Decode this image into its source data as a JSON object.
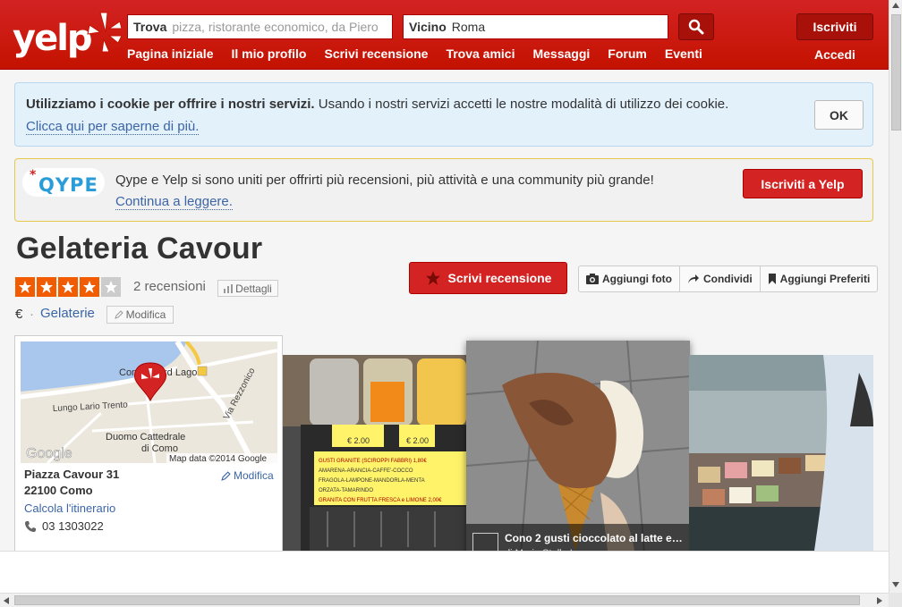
{
  "colors": {
    "brand_red": "#d32323",
    "dark_red": "#a8100a",
    "link_blue": "#3b65a7",
    "star_orange": "#f15c00"
  },
  "header": {
    "logo": "yelp",
    "find_label": "Trova",
    "find_placeholder": "pizza, ristorante economico, da Piero",
    "near_label": "Vicino",
    "near_value": "Roma",
    "search_icon": "search-icon",
    "nav": [
      "Pagina iniziale",
      "Il mio profilo",
      "Scrivi recensione",
      "Trova amici",
      "Messaggi",
      "Forum",
      "Eventi"
    ],
    "signup_label": "Iscriviti",
    "login_label": "Accedi"
  },
  "cookie_banner": {
    "bold_text": "Utilizziamo i cookie per offrire i nostri servizi.",
    "text": "Usando i nostri servizi accetti le nostre modalità di utilizzo dei cookie.",
    "link": "Clicca qui per saperne di più.",
    "ok_label": "OK"
  },
  "qype_banner": {
    "logo": "QYPE",
    "text": "Qype e Yelp si sono uniti per offrirti più recensioni, più attività e una community più grande!",
    "link": "Continua a leggere.",
    "button": "Iscriviti a Yelp"
  },
  "business": {
    "name": "Gelateria Cavour",
    "rating": 4,
    "rating_max": 5,
    "reviews_count": "2 recensioni",
    "details_label": "Dettagli",
    "price": "€",
    "category": "Gelaterie",
    "modify_label": "Modifica",
    "write_review_label": "Scrivi recensione",
    "actions": [
      "Aggiungi foto",
      "Condividi",
      "Aggiungi Preferiti"
    ]
  },
  "map": {
    "labels": {
      "place": "Cond",
      "place2": "rd Lago",
      "street1": "Lungo Lario Trento",
      "street2": "Via Rezzonico",
      "church": "Duomo Cattedrale",
      "church2": "di Como",
      "google": "Google",
      "copyright": "Map data ©2014 Google"
    },
    "address_line1": "Piazza Cavour 31",
    "address_line2": "22100 Como",
    "modify_label": "Modifica",
    "directions_label": "Calcola l'itinerario",
    "phone": "03 1303022"
  },
  "photos": {
    "caption_title": "Cono 2 gusti cioccolato al latte e…",
    "caption_author": "di Maria Stella I.",
    "sign1": "GUSTI GRANITE (SCIROPPI FABBRI) 1,80€",
    "sign2": "AMARENA-ARANCIA-CAFFE'-COCCO",
    "sign3": "FRAGOLA-LAMPONE-MANDORLA-MENTA",
    "sign4": "ORZATA-TAMARINDO",
    "sign5": "GRANITA CON FRUTTA FRESCA e LIMONE 2,00€",
    "price1": "€ 2.00",
    "price2": "€ 2.00"
  }
}
